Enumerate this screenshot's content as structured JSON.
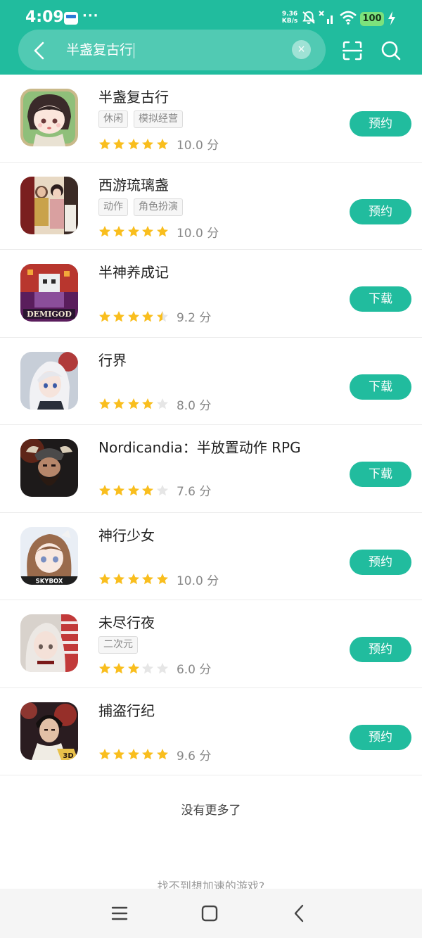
{
  "status_bar": {
    "time": "4:09",
    "dots": "···",
    "net_speed_value": "9.36",
    "net_speed_unit": "KB/s",
    "battery": "100"
  },
  "search": {
    "query": "半盏复古行",
    "clear_symbol": "×"
  },
  "colors": {
    "primary": "#21BC9E",
    "star_full": "#F9BE1E",
    "star_empty": "#E6E6E6"
  },
  "results": [
    {
      "title": "半盏复古行",
      "tags": [
        "休闲",
        "模拟经营"
      ],
      "stars": 5,
      "score": "10.0 分",
      "action": "预约",
      "icon": "game-icon-chibi-girl"
    },
    {
      "title": "西游琉璃盏",
      "tags": [
        "动作",
        "角色扮演"
      ],
      "stars": 5,
      "score": "10.0 分",
      "action": "预约",
      "icon": "game-icon-journey-characters"
    },
    {
      "title": "半神养成记",
      "tags": [],
      "stars": 4.5,
      "score": "9.2 分",
      "action": "下载",
      "icon": "game-icon-demigod-pixel"
    },
    {
      "title": "行界",
      "tags": [],
      "stars": 4,
      "score": "8.0 分",
      "action": "下载",
      "icon": "game-icon-silver-hair-girl"
    },
    {
      "title": "Nordicandia：半放置动作 RPG",
      "tags": [],
      "stars": 4,
      "score": "7.6 分",
      "action": "下载",
      "icon": "game-icon-viking-warrior"
    },
    {
      "title": "神行少女",
      "tags": [],
      "stars": 5,
      "score": "10.0 分",
      "action": "预约",
      "icon": "game-icon-skybox-girl"
    },
    {
      "title": "未尽行夜",
      "tags": [
        "二次元"
      ],
      "stars": 3,
      "score": "6.0 分",
      "action": "预约",
      "icon": "game-icon-white-hair-girl"
    },
    {
      "title": "捕盗行纪",
      "tags": [],
      "stars": 5,
      "score": "9.6 分",
      "action": "预约",
      "icon": "game-icon-swordsman-3d"
    }
  ],
  "icon_texts": {
    "demigod": "DEMIGOD",
    "skybox": "SKYBOX",
    "threed": "3D"
  },
  "footer": {
    "no_more": "没有更多了",
    "cant_find": "找不到想加速的游戏?"
  }
}
